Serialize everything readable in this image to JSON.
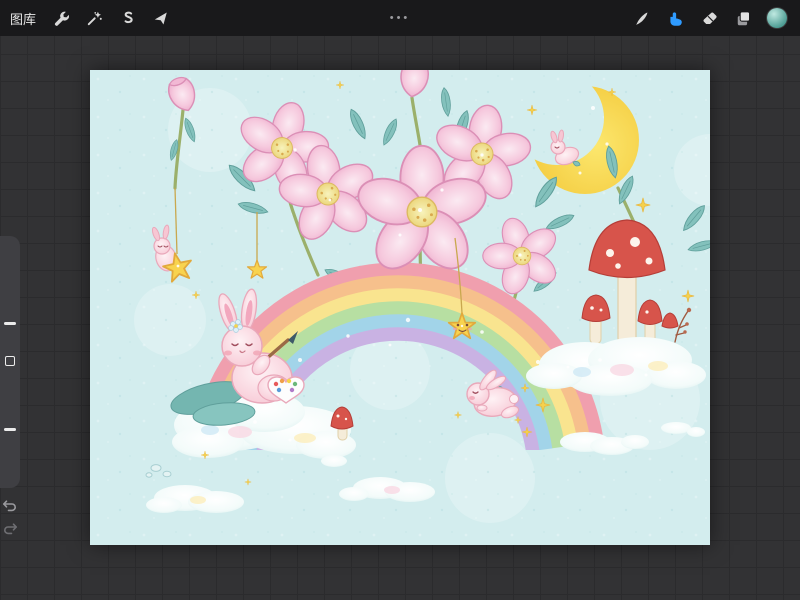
{
  "topbar": {
    "gallery_label": "图库",
    "center_dots": "•••",
    "left_tools": [
      {
        "name": "actions",
        "icon": "wrench-icon"
      },
      {
        "name": "adjustments",
        "icon": "magic-wand-icon"
      },
      {
        "name": "selection",
        "icon": "selection-s-icon"
      },
      {
        "name": "transform",
        "icon": "transform-arrow-icon"
      }
    ],
    "right_tools": [
      {
        "name": "paint",
        "icon": "brush-icon",
        "active": false
      },
      {
        "name": "smudge",
        "icon": "smudge-finger-icon",
        "active": true
      },
      {
        "name": "erase",
        "icon": "eraser-icon",
        "active": false
      },
      {
        "name": "layers",
        "icon": "layers-icon",
        "active": false
      },
      {
        "name": "color",
        "icon": "color-swatch",
        "active": false
      }
    ]
  },
  "sidebar": {
    "controls": [
      "brush-size-slider",
      "modify-button",
      "opacity-slider",
      "undo-button",
      "redo-button"
    ]
  },
  "canvas": {
    "subjects": [
      "pink-flowers",
      "rainbow",
      "crescent-moon",
      "bunnies",
      "mushrooms",
      "hanging-stars",
      "pastel-clouds",
      "sparkles"
    ],
    "palette": {
      "background": "#d3edee",
      "flower_pink": "#f6cade",
      "flower_edge": "#db8fb6",
      "flower_center": "#ecd77e",
      "bunny_pink": "#f7c6d3",
      "moon_yellow": "#f3c93b",
      "star_yellow": "#f8d34f",
      "mushroom_red": "#d7544b",
      "leaf_teal": "#83c1bc",
      "stem_green": "#9bb06b",
      "cloud_white": "#f3fbfa",
      "rainbow_bands": [
        "#f09fae",
        "#f6c08c",
        "#f9e48f",
        "#b7dfa2",
        "#a2d4e9",
        "#c9b2e3"
      ]
    }
  },
  "theme": {
    "topbar_bg": "#19191b",
    "workspace_bg": "#323234",
    "grid_line": "#2b2b2d",
    "icon_color": "#d9d9d9",
    "icon_dim": "#8f8f93",
    "accent_blue": "#2f9bff",
    "sidebar_bg": "#3f3f43",
    "sidebar_handle": "#ececec",
    "dots_color": "#9a9a9e",
    "color_swatch_inner": "#bfe9e1",
    "color_swatch_outer": "#4e9d94",
    "canvas_bg": "#d3edee"
  }
}
